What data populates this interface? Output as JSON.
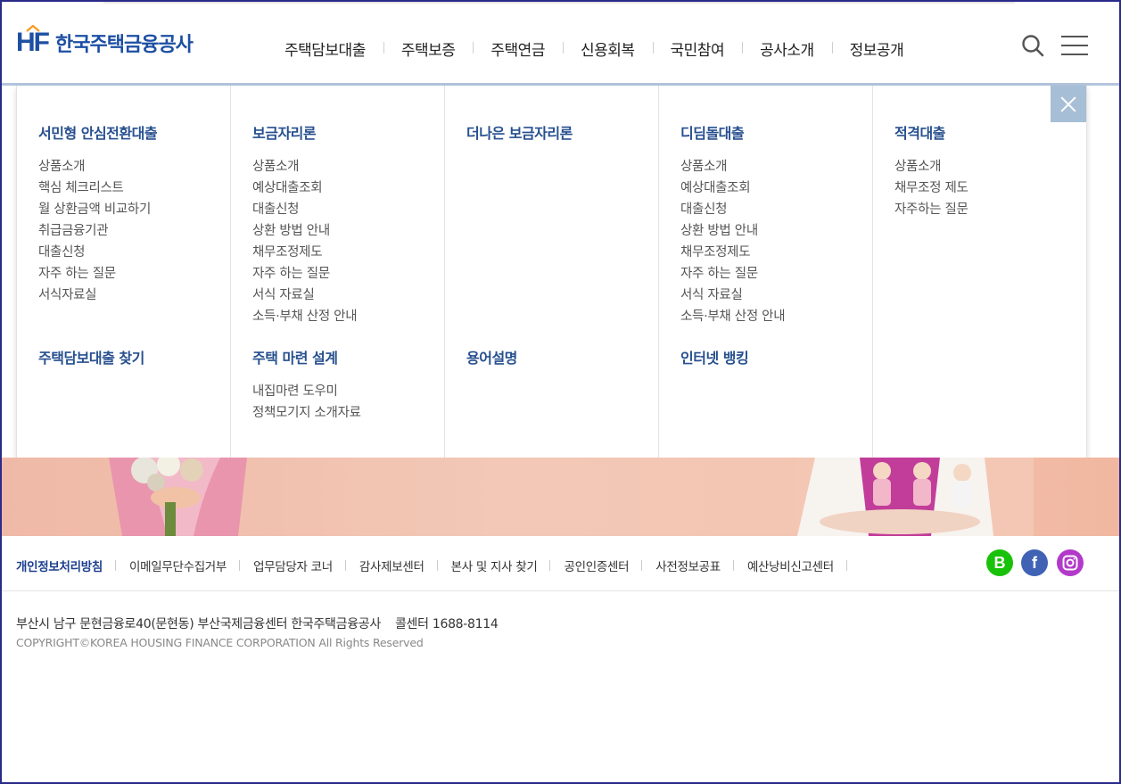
{
  "header": {
    "logo_mark": "HF",
    "logo_text": "한국주택금융공사",
    "nav": [
      "주택담보대출",
      "주택보증",
      "주택연금",
      "신용회복",
      "국민참여",
      "공사소개",
      "정보공개"
    ]
  },
  "mega_menu": {
    "columns": [
      {
        "groups": [
          {
            "title": "서민형 안심전환대출",
            "items": [
              "상품소개",
              "핵심 체크리스트",
              "월 상환금액 비교하기",
              "취급금융기관",
              "대출신청",
              "자주 하는 질문",
              "서식자료실"
            ]
          },
          {
            "title": "주택담보대출 찾기",
            "items": []
          }
        ]
      },
      {
        "groups": [
          {
            "title": "보금자리론",
            "items": [
              "상품소개",
              "예상대출조회",
              "대출신청",
              "상환 방법 안내",
              "채무조정제도",
              "자주 하는 질문",
              "서식 자료실",
              "소득·부채 산정 안내"
            ]
          },
          {
            "title": "주택 마련 설계",
            "items": [
              "내집마련 도우미",
              "정책모기지 소개자료"
            ]
          }
        ]
      },
      {
        "groups": [
          {
            "title": "더나은 보금자리론",
            "items": []
          },
          {
            "title": "용어설명",
            "items": []
          }
        ]
      },
      {
        "groups": [
          {
            "title": "디딤돌대출",
            "items": [
              "상품소개",
              "예상대출조회",
              "대출신청",
              "상환 방법 안내",
              "채무조정제도",
              "자주 하는 질문",
              "서식 자료실",
              "소득·부채 산정 안내"
            ]
          },
          {
            "title": "인터넷 뱅킹",
            "items": []
          }
        ]
      },
      {
        "groups": [
          {
            "title": "적격대출",
            "items": [
              "상품소개",
              "채무조정 제도",
              "자주하는 질문"
            ]
          }
        ]
      }
    ]
  },
  "footer": {
    "links": [
      "개인정보처리방침",
      "이메일무단수집거부",
      "업무담당자 코너",
      "감사제보센터",
      "본사 및 지사 찾기",
      "공인인증센터",
      "사전정보공표",
      "예산낭비신고센터"
    ],
    "social": [
      {
        "name": "blog",
        "glyph": "B",
        "color": "#19c20a"
      },
      {
        "name": "facebook",
        "glyph": "f",
        "color": "#3f62b5"
      },
      {
        "name": "instagram",
        "glyph": "",
        "color": "#b239c9"
      }
    ],
    "address": "부산시 남구 문현금융로40(문현동) 부산국제금융센터 한국주택금융공사",
    "call_center": "콜센터 1688-8114",
    "copyright": "COPYRIGHT©KOREA HOUSING FINANCE CORPORATION All Rights Reserved"
  },
  "colors": {
    "brand": "#1d4fa3",
    "menu_title": "#27508f",
    "close_button": "#a7bfd6",
    "logo_roof": "#f59b1e"
  }
}
